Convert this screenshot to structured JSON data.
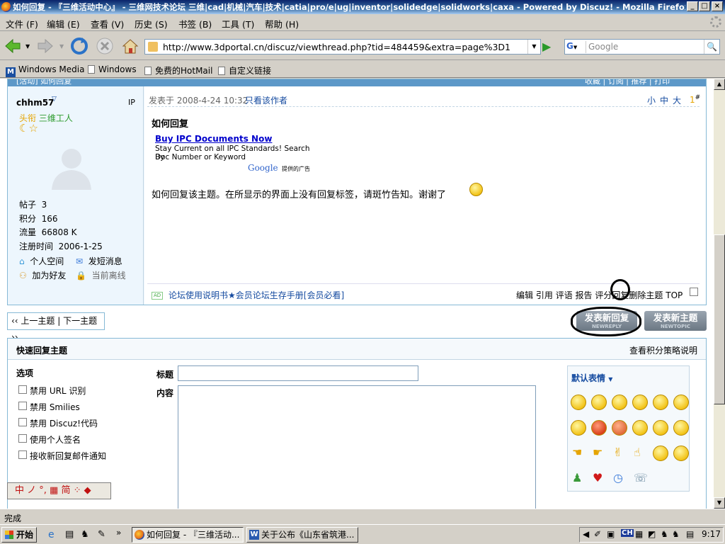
{
  "window": {
    "title": "如何回复 - 『三维活动中心』 - 三维网技术论坛 三维|cad|机械|汽车|技术|catia|pro/e|ug|inventor|solidedge|solidworks|caxa - Powered by Discuz! - Mozilla Firefox",
    "min": "_",
    "max": "□",
    "close": "×"
  },
  "menu": [
    "文件 (F)",
    "编辑 (E)",
    "查看 (V)",
    "历史 (S)",
    "书签 (B)",
    "工具 (T)",
    "帮助 (H)"
  ],
  "nav": {
    "url": "http://www.3dportal.cn/discuz/viewthread.php?tid=484459&extra=page%3D1",
    "search_placeholder": "Google",
    "search_engine": "G"
  },
  "bookmarks": [
    "Windows Media",
    "Windows",
    "免费的HotMail",
    "自定义链接"
  ],
  "post_header": {
    "left": "[活动] 如何回复",
    "right": "收藏 | 订阅 | 推荐 | 打印"
  },
  "author": {
    "name": "chhm57",
    "ip": "IP",
    "title_label": "头衔",
    "title": "三维工人",
    "stats": [
      {
        "label": "帖子",
        "value": "3"
      },
      {
        "label": "积分",
        "value": "166"
      },
      {
        "label": "流量",
        "value": "66808 K"
      },
      {
        "label": "注册时间",
        "value": "2006-1-25"
      }
    ],
    "actions": [
      "个人空间",
      "发短消息",
      "加为好友",
      "当前离线"
    ]
  },
  "post": {
    "posted_at": "发表于 2008-4-24 10:32",
    "only_author": "只看该作者",
    "font_sizes": [
      "小",
      "中",
      "大"
    ],
    "floor": "1",
    "floor_sup": "#",
    "title": "如何回复",
    "ad": {
      "headline": "Buy IPC Documents Now",
      "line1": "Stay Current on all IPC Standards! Search By",
      "line2": "Doc Number or Keyword",
      "by": "Google",
      "by_suffix": "提供的广告"
    },
    "body": "如何回复该主题。在所显示的界面上没有回复标签，请斑竹告知。谢谢了",
    "footer_ad_badge": "AD",
    "footer_links": "论坛使用说明书★会员论坛生存手册[会员必看]",
    "actions": [
      "编辑",
      "引用",
      "评语",
      "报告",
      "评分",
      "回复",
      "删除主题",
      "TOP"
    ]
  },
  "thread_nav": "‹‹ 上一主题 | 下一主题 ››",
  "buttons": {
    "new_reply": "发表新回复",
    "new_reply_en": "NEWREPLY",
    "new_topic": "发表新主题",
    "new_topic_en": "NEWTOPIC"
  },
  "quick_reply": {
    "title": "快速回复主题",
    "help": "查看积分策略说明",
    "options_title": "选项",
    "options": [
      "禁用 URL 识别",
      "禁用 Smilies",
      "禁用 Discuz!代码",
      "使用个人签名",
      "接收新回复邮件通知"
    ],
    "subject_label": "标题",
    "content_label": "内容",
    "smilies_title": "默认表情"
  },
  "ime": "中 ノ °, ▦ 简 ⁘ ◆",
  "status": "完成",
  "taskbar": {
    "start": "开始",
    "tasks": [
      "如何回复 - 『三维活动...",
      "关于公布《山东省筑港..."
    ],
    "tray_lang": "CH",
    "clock": "9:17"
  },
  "colors": {
    "link_blue": "#154ba0",
    "title_orange": "#e5a400",
    "title_green": "#2d9b2d",
    "post_bg": "#edf6fd",
    "button_gray": "#8a95a0"
  }
}
